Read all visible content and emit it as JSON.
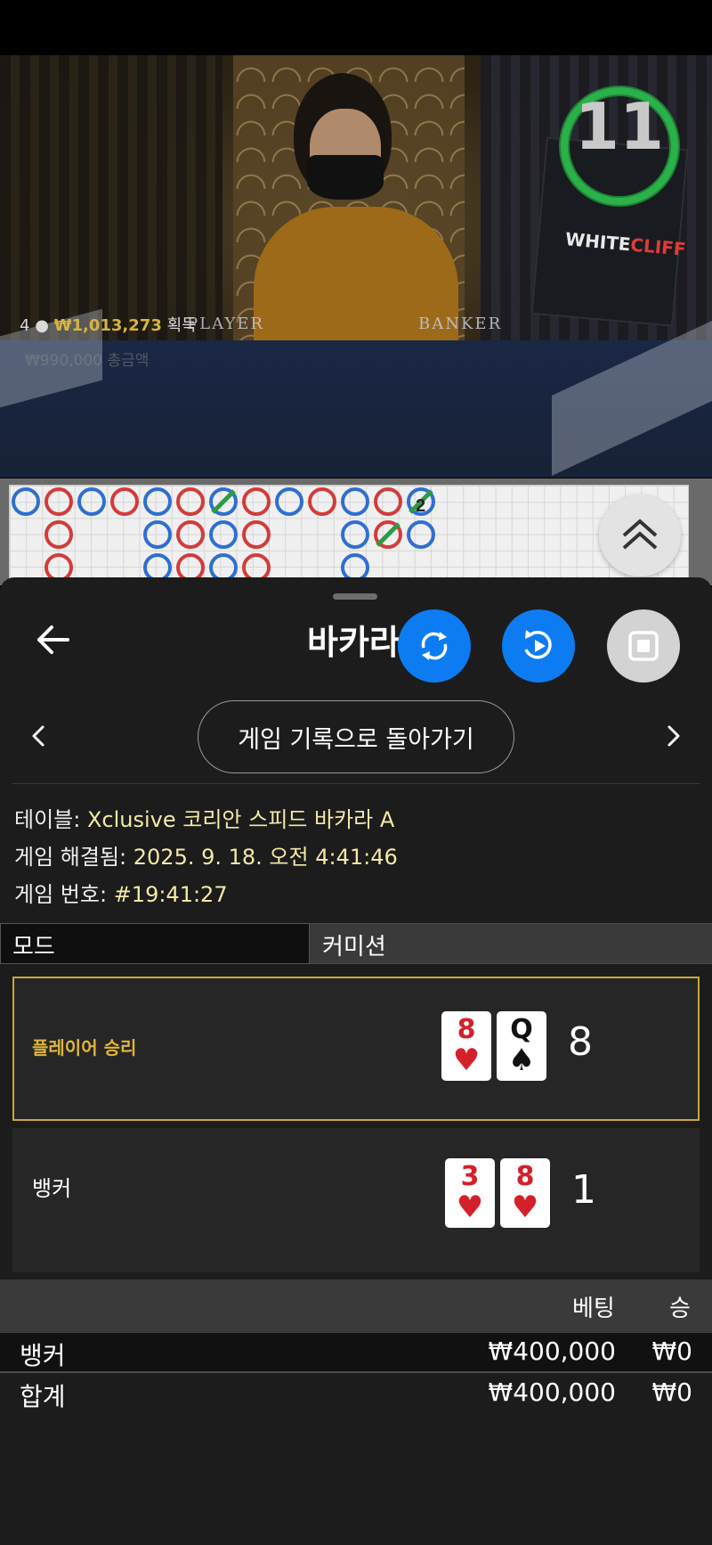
{
  "video": {
    "timer": "11",
    "winners_count": "4",
    "winners_amount": "₩1,013,273",
    "winners_suffix": "획득",
    "winners_faded": "₩990,000 총금액",
    "table_labels": [
      "PLAYER",
      "BANKER"
    ],
    "sign_brand_white": "WHITE",
    "sign_brand_red": "CLIFF",
    "road_mark": "2"
  },
  "header": {
    "title": "바카라",
    "back_icon": "arrow-left-icon",
    "controls": [
      {
        "icon": "swap-cycle-icon",
        "color": "#0d7cf2"
      },
      {
        "icon": "replay-icon",
        "color": "#0d7cf2"
      },
      {
        "icon": "stop-icon",
        "color": "#d3d3d3"
      }
    ]
  },
  "history_nav": {
    "button_label": "게임 기록으로 돌아가기"
  },
  "game_info": {
    "table_label": "테이블:",
    "table_value": "Xclusive 코리안 스피드 바카라 A",
    "resolved_label": "게임 해결됨:",
    "resolved_value": "2025. 9. 18. 오전 4:41:46",
    "number_label": "게임 번호:",
    "number_value": "#19:41:27"
  },
  "mode": {
    "label": "모드",
    "value": "커미션"
  },
  "results": {
    "player": {
      "label": "플레이어 승리",
      "cards": [
        {
          "rank": "8",
          "suit": "♥",
          "color": "red"
        },
        {
          "rank": "Q",
          "suit": "♠",
          "color": "black"
        }
      ],
      "score": "8"
    },
    "banker": {
      "label": "뱅커",
      "cards": [
        {
          "rank": "3",
          "suit": "♥",
          "color": "red"
        },
        {
          "rank": "8",
          "suit": "♥",
          "color": "red"
        }
      ],
      "score": "1"
    }
  },
  "bets": {
    "col_bet": "베팅",
    "col_win": "승",
    "rows": [
      {
        "name": "뱅커",
        "bet": "₩400,000",
        "win": "₩0"
      }
    ],
    "total": {
      "name": "합계",
      "bet": "₩400,000",
      "win": "₩0"
    }
  },
  "colors": {
    "accent_blue": "#0d7cf2",
    "win_gold": "#c8a83a",
    "card_red": "#d4202a"
  }
}
